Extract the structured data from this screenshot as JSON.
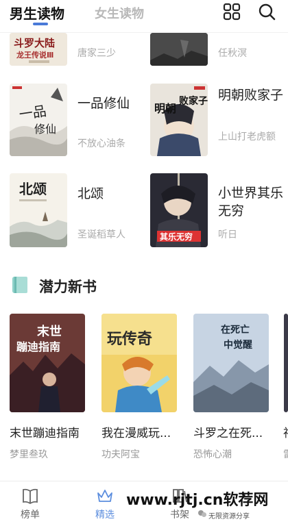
{
  "header": {
    "tab_male": "男生读物",
    "tab_female": "女生读物"
  },
  "top_partial": {
    "left_author": "唐家三少",
    "right_author": "任秋溟",
    "left_cover_text": "斗罗大陆",
    "left_cover_sub": "龙王传说Ⅲ"
  },
  "books": [
    {
      "title": "一品修仙",
      "author": "不放心油条",
      "cover_text": "一品修仙"
    },
    {
      "title": "明朝败家子",
      "author": "上山打老虎额",
      "cover_text": "明朝败家子"
    },
    {
      "title": "北颂",
      "author": "圣诞稻草人",
      "cover_text": "北颂"
    },
    {
      "title": "小世界其乐无穷",
      "author": "听日",
      "cover_text": "小世界其乐无穷"
    }
  ],
  "section": {
    "title": "潜力新书"
  },
  "new_books": [
    {
      "title": "末世蹦迪指南",
      "author": "梦里叁玖",
      "cover_text": "末世蹦迪指南"
    },
    {
      "title": "我在漫威玩...",
      "author": "功夫阿宝",
      "cover_text": "玩传奇"
    },
    {
      "title": "斗罗之在死...",
      "author": "恐怖心潮",
      "cover_text": "在死亡中觉醒"
    },
    {
      "title": "神",
      "author": "雷"
    }
  ],
  "nav": {
    "items": [
      {
        "label": "榜单",
        "icon": "book-open-icon"
      },
      {
        "label": "精选",
        "icon": "crown-icon"
      },
      {
        "label": "书架",
        "icon": "bookshelf-icon"
      }
    ]
  },
  "watermark": {
    "text": "www.rjtj.cn软荐网",
    "note": "无限资源分享"
  },
  "colors": {
    "accent": "#5b8dde",
    "section_icon": "#7fc8c0"
  }
}
